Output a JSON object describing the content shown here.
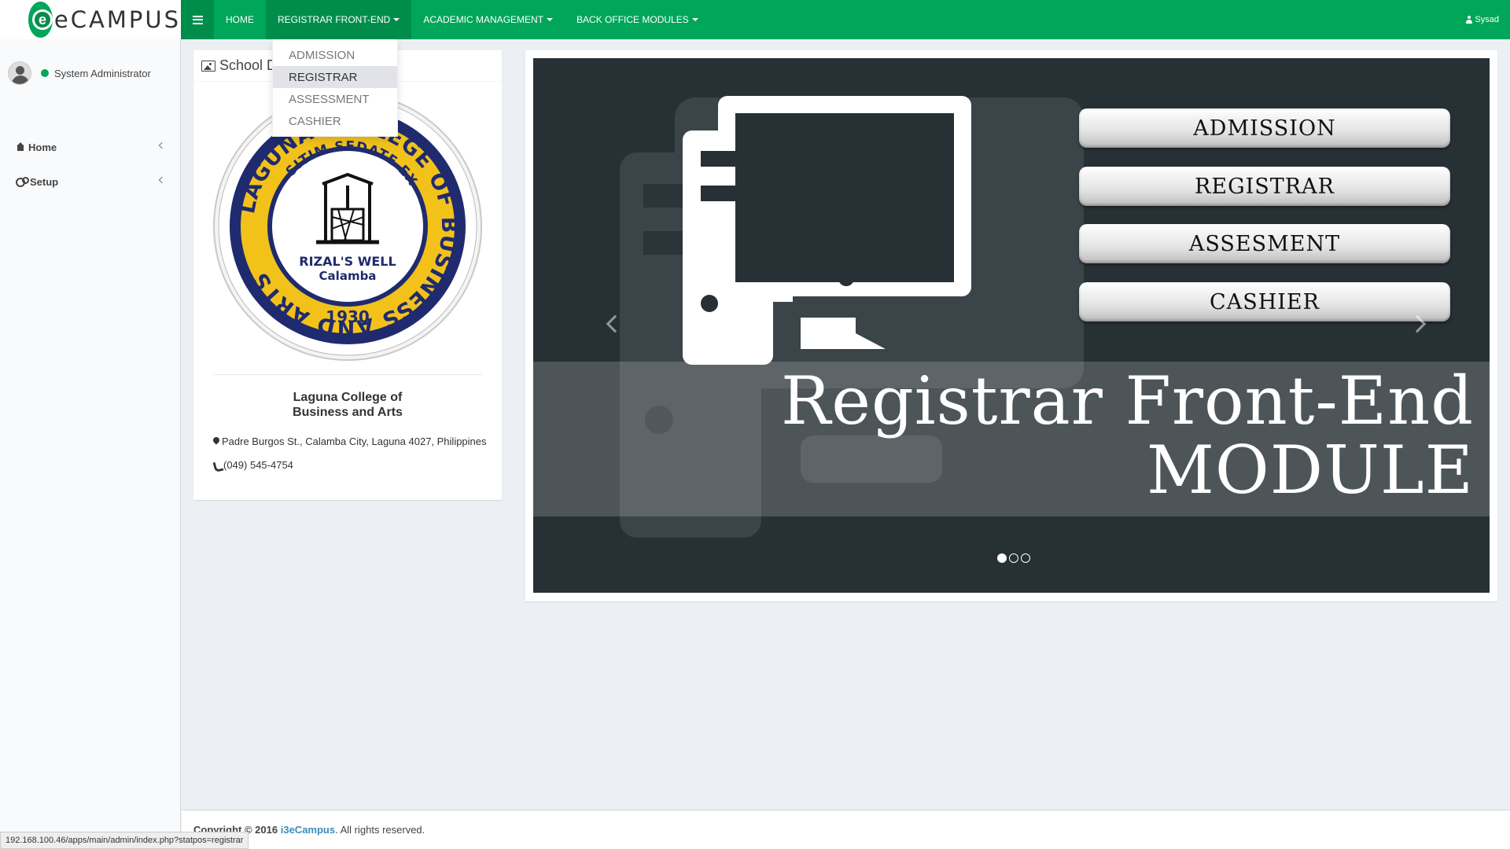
{
  "brand": {
    "logo_letter": "e",
    "logo_text": "eCAMPUS"
  },
  "nav": {
    "items": [
      {
        "label": "HOME"
      },
      {
        "label": "REGISTRAR FRONT-END"
      },
      {
        "label": "ACADEMIC MANAGEMENT"
      },
      {
        "label": "BACK OFFICE MODULES"
      }
    ],
    "user_label": "Sysad"
  },
  "dropdown": {
    "items": [
      "ADMISSION",
      "REGISTRAR",
      "ASSESSMENT",
      "CASHIER"
    ],
    "active_index": 1
  },
  "sidebar": {
    "user_name": "System Administrator",
    "items": [
      {
        "label": "Home"
      },
      {
        "label": "Setup"
      }
    ]
  },
  "school": {
    "header": "School D",
    "name_line1": "Laguna College of",
    "name_line2": "Business and Arts",
    "address": "Padre Burgos St., Calamba City, Laguna 4027, Philippines",
    "phone": "(049) 545-4754",
    "seal": {
      "ring_text": "LAGUNA COLLEGE OF BUSINESS AND ARTS",
      "motto": "SITIM SEDATE EX",
      "caption1": "RIZAL'S WELL",
      "caption2": "Calamba",
      "year": "1930"
    }
  },
  "carousel": {
    "buttons": [
      "ADMISSION",
      "REGISTRAR",
      "ASSESMENT",
      "CASHIER"
    ],
    "title_line1": "Registrar Front-End",
    "title_line2": "MODULE",
    "slide_count": 3,
    "active_slide": 0
  },
  "footer": {
    "copyright": "Copyright © 2016",
    "link": "i3eCampus",
    "rest": ". All rights reserved."
  },
  "status_url": "192.168.100.46/apps/main/admin/index.php?statpos=registrar",
  "colors": {
    "brand_green": "#00a65a",
    "brand_green_dark": "#008d4c",
    "link_blue": "#3c8dbc",
    "seal_navy": "#1f2b6e",
    "seal_gold": "#f2c21b"
  }
}
